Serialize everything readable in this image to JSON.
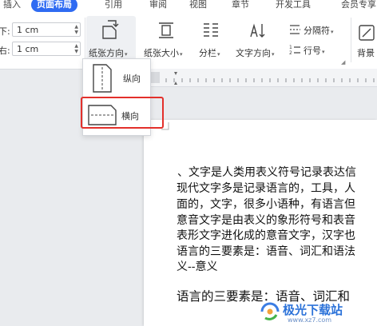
{
  "tabs": [
    {
      "label": "插入"
    },
    {
      "label": "页面布局",
      "active": true
    },
    {
      "label": "引用"
    },
    {
      "label": "审阅"
    },
    {
      "label": "视图"
    },
    {
      "label": "章节"
    },
    {
      "label": "开发工具"
    },
    {
      "label": "会员专享"
    }
  ],
  "margins": {
    "top_label": "下:",
    "top_value": "1 cm",
    "bottom_label": "右:",
    "bottom_value": "1 cm"
  },
  "ribbon": {
    "orientation": "纸张方向",
    "paper_size": "纸张大小",
    "columns": "分栏",
    "text_direction": "文字方向",
    "breaks": "分隔符",
    "line_numbers": "行号",
    "background": "背景"
  },
  "dropdown": {
    "portrait": "纵向",
    "landscape": "横向"
  },
  "document": {
    "lines": [
      "、文字是人类用表义符号记录表达信",
      "现代文字多是记录语言的，工具，人",
      "面的，文字，很多小语种，有语言但",
      "意音文字是由表义的象形符号和表音",
      "表形文字进化成的意音文字，汉字也",
      "语言的三要素是：语音、词汇和语法",
      "义--意义"
    ],
    "heading_line": "语言的三要素是：语音、词汇和"
  },
  "watermark": {
    "text": "极光下载站",
    "url": "www.xz7.com"
  },
  "colors": {
    "accent": "#2f6bf2",
    "highlight": "#e3302b"
  }
}
